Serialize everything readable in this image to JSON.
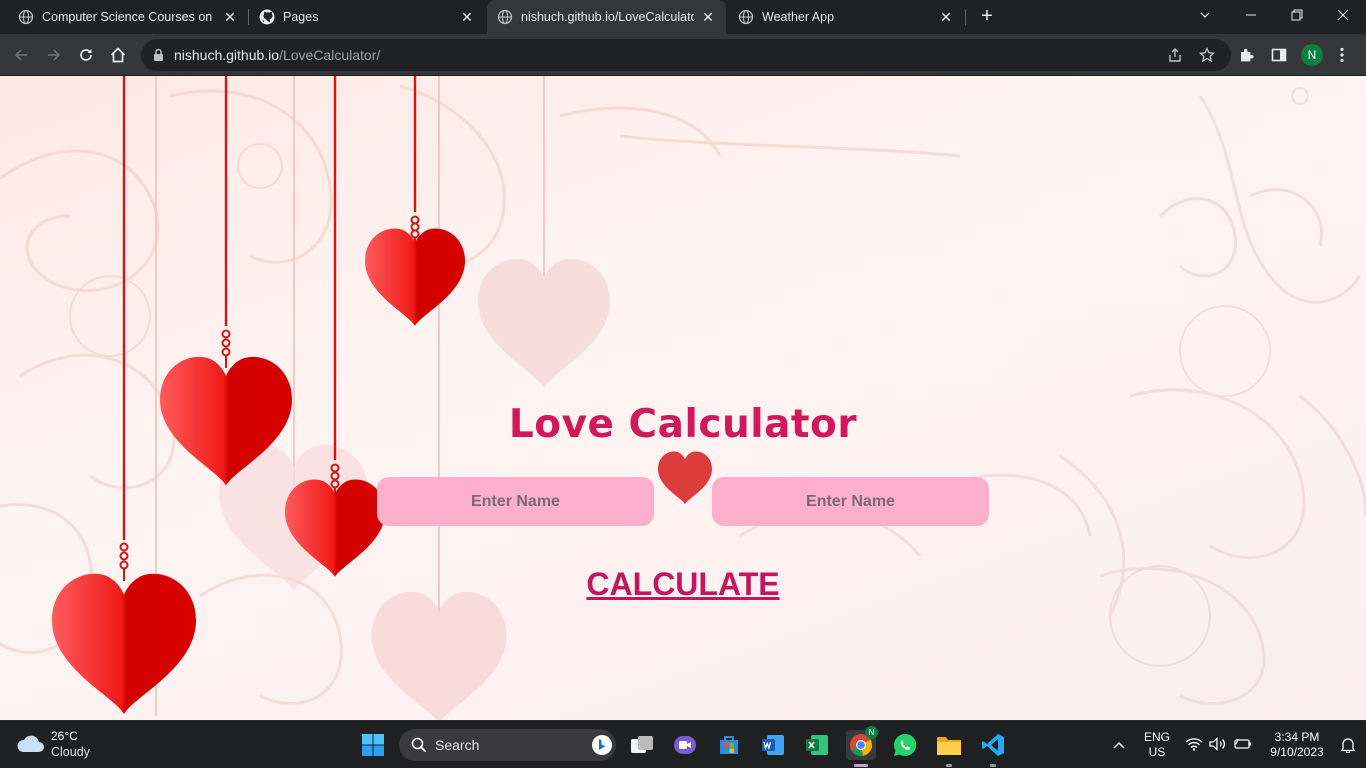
{
  "browser": {
    "tabs": [
      {
        "label": "Computer Science Courses on Le",
        "icon": "globe-icon",
        "active": false
      },
      {
        "label": "Pages",
        "icon": "github-icon",
        "active": false
      },
      {
        "label": "nishuch.github.io/LoveCalculator/",
        "icon": "globe-icon",
        "active": true
      },
      {
        "label": "Weather App",
        "icon": "globe-icon",
        "active": false
      }
    ],
    "url_host": "nishuch.github.io",
    "url_path": "/LoveCalculator/",
    "profile_initial": "N"
  },
  "page": {
    "title": "Love Calculator",
    "name1_placeholder": "Enter Name",
    "name2_placeholder": "Enter Name",
    "calculate_label": "CALCULATE",
    "colors": {
      "title": "#d0185a",
      "input_bg": "#fdafcb",
      "heart": "#e10e0e"
    }
  },
  "taskbar": {
    "weather_temp": "26°C",
    "weather_desc": "Cloudy",
    "search_label": "Search",
    "lang_line1": "ENG",
    "lang_line2": "US",
    "time": "3:34 PM",
    "date": "9/10/2023"
  }
}
